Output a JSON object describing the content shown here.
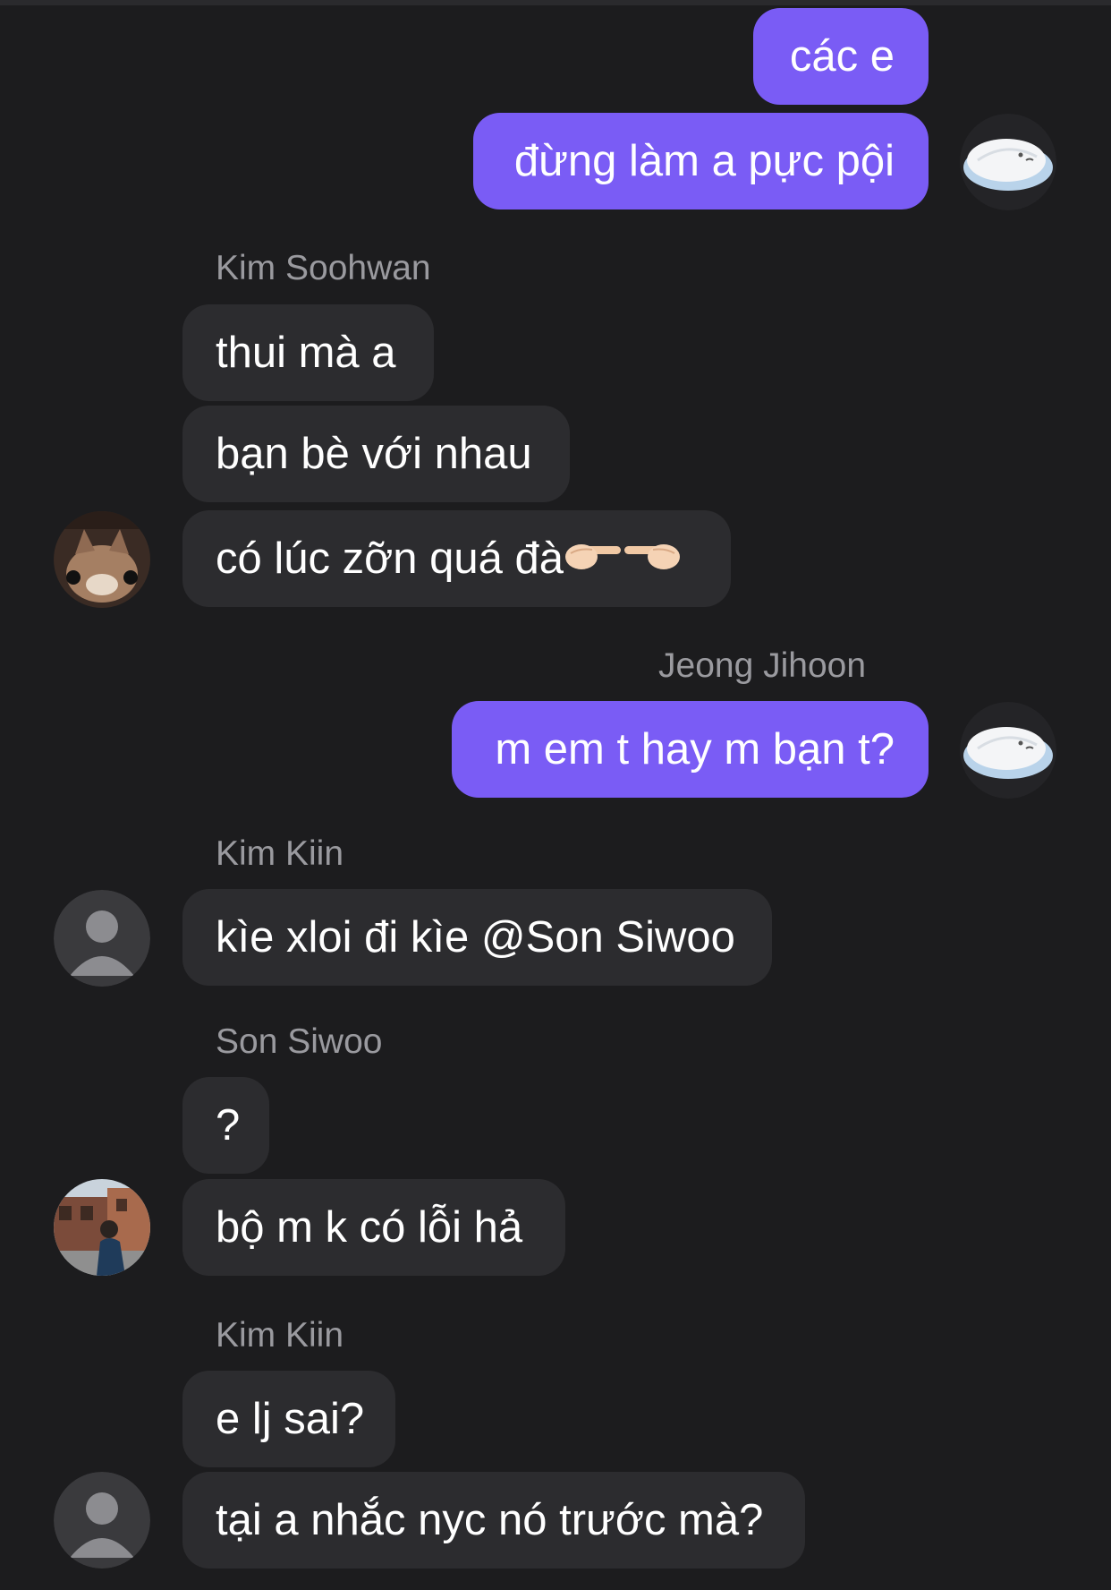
{
  "colors": {
    "background": "#1c1c1e",
    "outgoing_bubble": "#7a5cf5",
    "incoming_bubble": "#2c2c2f",
    "sender_name": "#9a9a9f"
  },
  "messages": {
    "m1": {
      "text": "các e"
    },
    "m2": {
      "text": "đừng làm a pực pội"
    },
    "g1_sender": "Kim Soohwan",
    "m3": {
      "text": "thui mà a"
    },
    "m4": {
      "text": "bạn bè với nhau"
    },
    "m5": {
      "text": "có lúc zỡn quá đà",
      "emoji": [
        "backhand-index-pointing-right-icon",
        "backhand-index-pointing-left-icon"
      ]
    },
    "g2_sender": "Jeong Jihoon",
    "m6": {
      "text": "m em t hay m bạn t?"
    },
    "g3_sender": "Kim Kiin",
    "m7": {
      "text": "kìe xloi đi kìe @Son Siwoo"
    },
    "g4_sender": "Son Siwoo",
    "m8": {
      "text": "?"
    },
    "m9": {
      "text": "bộ m k có lỗi hả"
    },
    "g5_sender": "Kim Kiin",
    "m10": {
      "text": "e lj sai?"
    },
    "m11": {
      "text": "tại a nhắc nyc nó trước mà?"
    }
  },
  "avatars": {
    "self": "sleeping-blob-avatar-icon",
    "kim_soohwan": "cat-photo-avatar",
    "kim_kiin": "default-person-avatar-icon",
    "son_siwoo": "street-photo-avatar"
  }
}
